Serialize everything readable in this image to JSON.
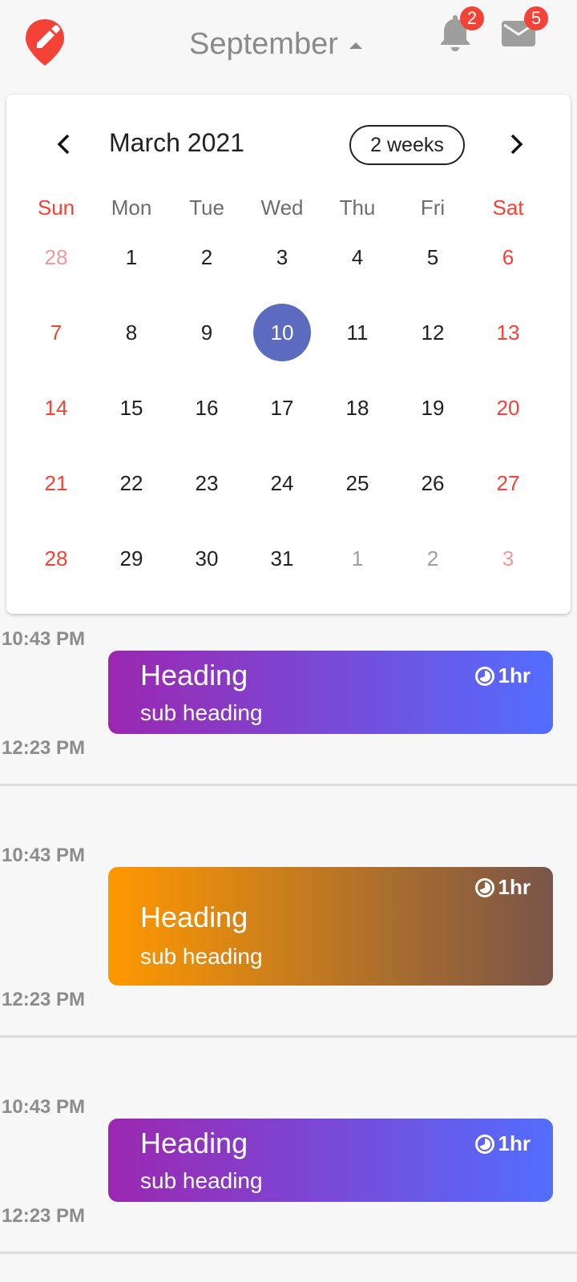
{
  "header": {
    "month_label": "September",
    "notifications_count": "2",
    "messages_count": "5"
  },
  "calendar": {
    "title": "March 2021",
    "format_button": "2 weeks",
    "weekdays": [
      "Sun",
      "Mon",
      "Tue",
      "Wed",
      "Thu",
      "Fri",
      "Sat"
    ],
    "selected_day": "10",
    "weeks": [
      [
        "28",
        "1",
        "2",
        "3",
        "4",
        "5",
        "6"
      ],
      [
        "7",
        "8",
        "9",
        "10",
        "11",
        "12",
        "13"
      ],
      [
        "14",
        "15",
        "16",
        "17",
        "18",
        "19",
        "20"
      ],
      [
        "21",
        "22",
        "23",
        "24",
        "25",
        "26",
        "27"
      ],
      [
        "28",
        "29",
        "30",
        "31",
        "1",
        "2",
        "3"
      ]
    ]
  },
  "events": [
    {
      "start": "10:43 PM",
      "end": "12:23 PM",
      "title": "Heading",
      "subtitle": "sub heading",
      "duration": "1hr",
      "gradient": [
        "#9c27b0",
        "#536dfe"
      ]
    },
    {
      "start": "10:43 PM",
      "end": "12:23 PM",
      "title": "Heading",
      "subtitle": "sub heading",
      "duration": "1hr",
      "gradient": [
        "#ff9800",
        "#795548"
      ]
    },
    {
      "start": "10:43 PM",
      "end": "12:23 PM",
      "title": "Heading",
      "subtitle": "sub heading",
      "duration": "1hr",
      "gradient": [
        "#9c27b0",
        "#536dfe"
      ]
    }
  ],
  "colors": {
    "accent": "#f44336",
    "selected": "#5c6bc0",
    "muted_text": "#8c8c8c"
  },
  "icons": [
    "edit-location-icon",
    "bell-icon",
    "mail-icon",
    "chevron-left-icon",
    "chevron-right-icon",
    "timelapse-icon"
  ]
}
